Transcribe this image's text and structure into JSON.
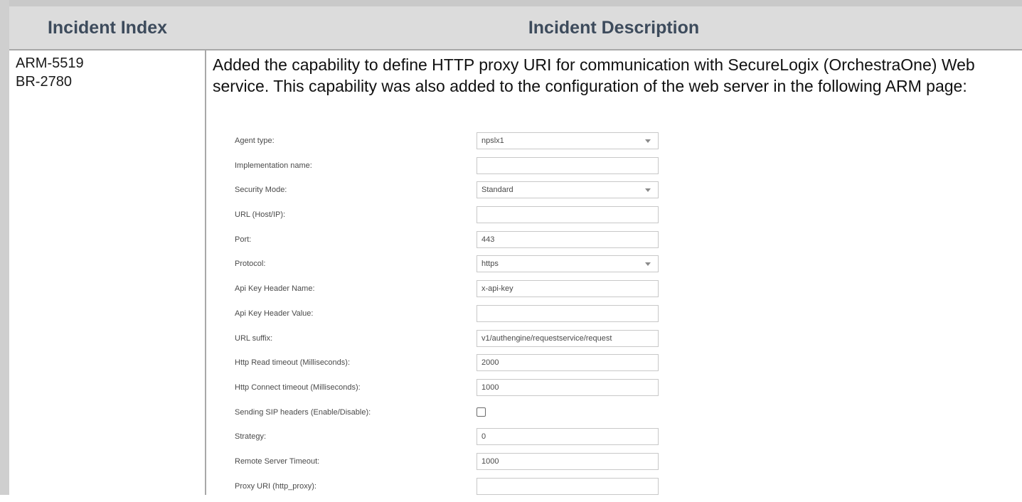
{
  "table": {
    "headers": {
      "index": "Incident Index",
      "description": "Incident Description"
    },
    "row": {
      "index_lines": [
        "ARM-5519",
        "BR-2780"
      ],
      "description": "Added the capability to define HTTP proxy URI for communication with SecureLogix (OrchestraOne) Web service. This capability was also added to the configuration of the web server in the following ARM page:"
    }
  },
  "form": {
    "fields": [
      {
        "label": "Agent type:",
        "type": "select",
        "value": "npslx1"
      },
      {
        "label": "Implementation name:",
        "type": "text",
        "value": ""
      },
      {
        "label": "Security Mode:",
        "type": "select",
        "value": "Standard"
      },
      {
        "label": "URL (Host/IP):",
        "type": "text",
        "value": ""
      },
      {
        "label": "Port:",
        "type": "text",
        "value": "443"
      },
      {
        "label": "Protocol:",
        "type": "select",
        "value": "https"
      },
      {
        "label": "Api Key Header Name:",
        "type": "text",
        "value": "x-api-key"
      },
      {
        "label": "Api Key Header Value:",
        "type": "text",
        "value": ""
      },
      {
        "label": "URL suffix:",
        "type": "text",
        "value": "v1/authengine/requestservice/request"
      },
      {
        "label": "Http Read timeout (Milliseconds):",
        "type": "text",
        "value": "2000"
      },
      {
        "label": "Http Connect timeout (Milliseconds):",
        "type": "text",
        "value": "1000"
      },
      {
        "label": "Sending SIP headers (Enable/Disable):",
        "type": "checkbox",
        "checked": false
      },
      {
        "label": "Strategy:",
        "type": "text",
        "value": "0"
      },
      {
        "label": "Remote Server Timeout:",
        "type": "text",
        "value": "1000"
      },
      {
        "label": "Proxy URI (http_proxy):",
        "type": "text",
        "value": ""
      }
    ]
  }
}
